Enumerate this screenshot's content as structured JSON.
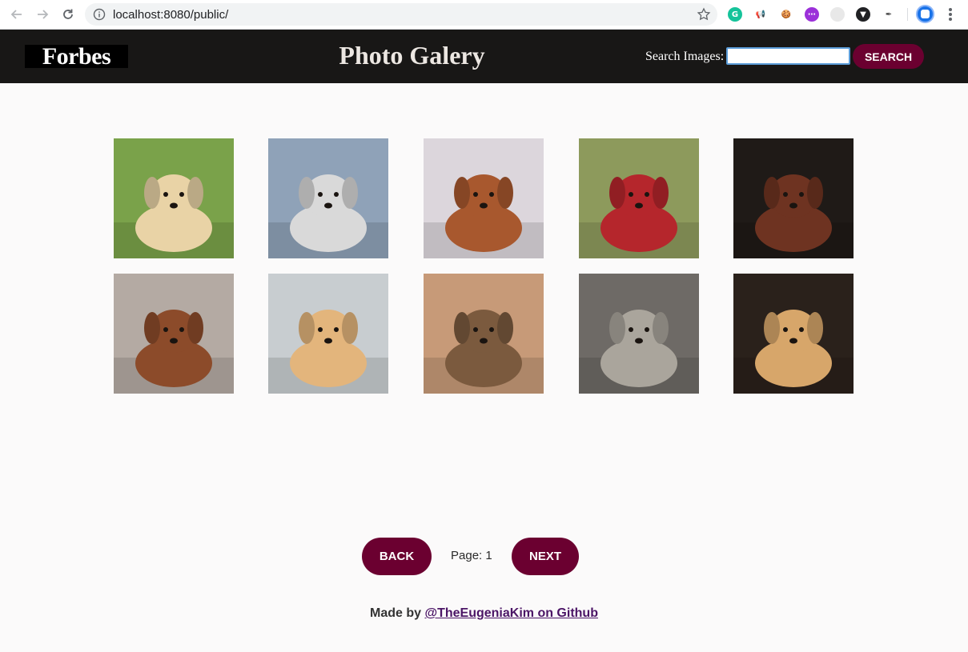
{
  "browser": {
    "url": "localhost:8080/public/",
    "extensions": [
      {
        "name": "grammarly-icon",
        "color": "#15c39a",
        "glyph": "G"
      },
      {
        "name": "megaphone-icon",
        "color": "#ffffff",
        "glyph": "📢"
      },
      {
        "name": "cookie-icon",
        "color": "#ffffff",
        "glyph": "🍪"
      },
      {
        "name": "purple-extension-icon",
        "color": "#9b30d9",
        "glyph": "⋯"
      },
      {
        "name": "grid-extension-icon",
        "color": "#e8e8e8",
        "glyph": ""
      },
      {
        "name": "vpn-icon",
        "color": "#202124",
        "glyph": "▼"
      },
      {
        "name": "feather-icon",
        "color": "#ffffff",
        "glyph": "✒"
      }
    ]
  },
  "header": {
    "logo": "Forbes",
    "title": "Photo Galery",
    "search_label": "Search Images:",
    "search_value": "",
    "search_button": "SEARCH"
  },
  "gallery": {
    "photos": [
      {
        "name": "golden-retriever-puppies",
        "bg": "#7aa24a",
        "fg": "#e9d3a6"
      },
      {
        "name": "australian-shepherd-puppies",
        "bg": "#8fa2b8",
        "fg": "#d9d9d9"
      },
      {
        "name": "cavalier-puppy-on-cushion",
        "bg": "#dcd6dc",
        "fg": "#a8582e"
      },
      {
        "name": "puppies-in-red-wagon",
        "bg": "#8d9a5c",
        "fg": "#b5262c"
      },
      {
        "name": "yawning-puppy",
        "bg": "#1f1a17",
        "fg": "#6e3321"
      },
      {
        "name": "dogs-in-costumes",
        "bg": "#b4aaa3",
        "fg": "#8c4b2a"
      },
      {
        "name": "golden-puppy-red-collar",
        "bg": "#c8cdd0",
        "fg": "#e3b57c"
      },
      {
        "name": "corgi-and-yorkie-running",
        "bg": "#c79a78",
        "fg": "#7b5a3e"
      },
      {
        "name": "mother-dog-with-newborns",
        "bg": "#6e6a66",
        "fg": "#aaa59c"
      },
      {
        "name": "cockapoo-puppy",
        "bg": "#2a211b",
        "fg": "#d7a66a"
      }
    ]
  },
  "pagination": {
    "back_label": "BACK",
    "page_text": "Page: 1",
    "next_label": "NEXT"
  },
  "footer": {
    "prefix": "Made by ",
    "link_text": "@TheEugeniaKim on Github"
  },
  "colors": {
    "accent": "#6b0030",
    "header_bg": "#181716",
    "page_bg": "#fbfafa"
  }
}
